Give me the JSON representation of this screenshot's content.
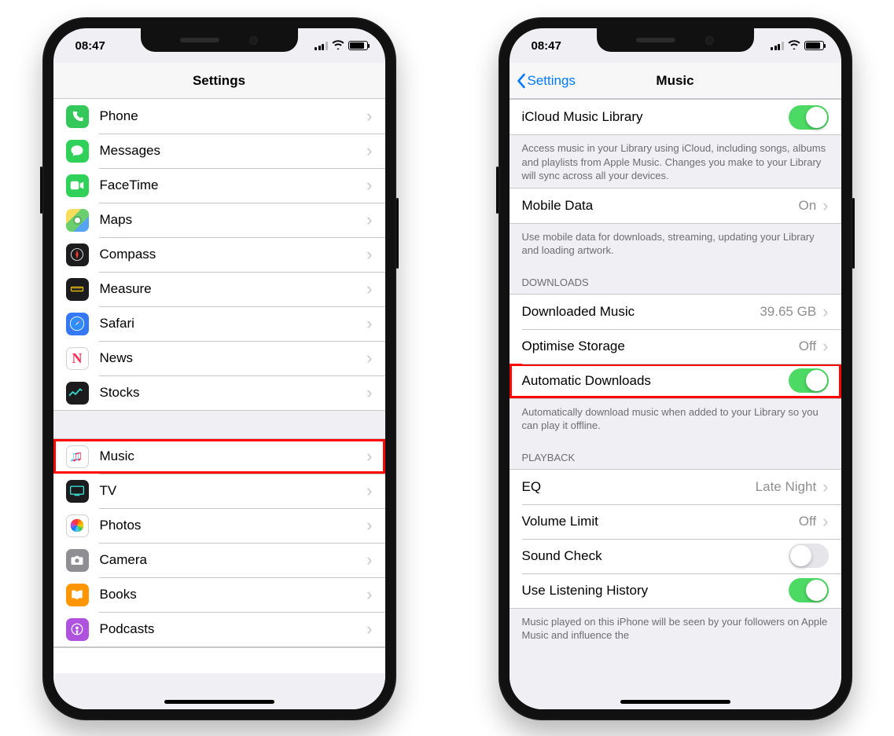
{
  "status": {
    "time": "08:47"
  },
  "left": {
    "title": "Settings",
    "group1": [
      {
        "label": "Phone",
        "icon": "phone-icon"
      },
      {
        "label": "Messages",
        "icon": "messages-icon"
      },
      {
        "label": "FaceTime",
        "icon": "facetime-icon"
      },
      {
        "label": "Maps",
        "icon": "maps-icon"
      },
      {
        "label": "Compass",
        "icon": "compass-icon"
      },
      {
        "label": "Measure",
        "icon": "measure-icon"
      },
      {
        "label": "Safari",
        "icon": "safari-icon"
      },
      {
        "label": "News",
        "icon": "news-icon"
      },
      {
        "label": "Stocks",
        "icon": "stocks-icon"
      }
    ],
    "group2": [
      {
        "label": "Music",
        "icon": "music-icon",
        "highlight": true
      },
      {
        "label": "TV",
        "icon": "tv-icon"
      },
      {
        "label": "Photos",
        "icon": "photos-icon"
      },
      {
        "label": "Camera",
        "icon": "camera-icon"
      },
      {
        "label": "Books",
        "icon": "books-icon"
      },
      {
        "label": "Podcasts",
        "icon": "podcasts-icon"
      }
    ]
  },
  "right": {
    "back": "Settings",
    "title": "Music",
    "icloud": {
      "label": "iCloud Music Library",
      "on": true,
      "footer": "Access music in your Library using iCloud, including songs, albums and playlists from Apple Music. Changes you make to your Library will sync across all your devices."
    },
    "mobile": {
      "label": "Mobile Data",
      "value": "On",
      "footer": "Use mobile data for downloads, streaming, updating your Library and loading artwork."
    },
    "downloads_header": "DOWNLOADS",
    "downloads": {
      "downloaded": {
        "label": "Downloaded Music",
        "value": "39.65 GB"
      },
      "optimise": {
        "label": "Optimise Storage",
        "value": "Off"
      },
      "auto": {
        "label": "Automatic Downloads",
        "on": true,
        "highlight": true
      },
      "footer": "Automatically download music when added to your Library so you can play it offline."
    },
    "playback_header": "PLAYBACK",
    "playback": {
      "eq": {
        "label": "EQ",
        "value": "Late Night"
      },
      "vol": {
        "label": "Volume Limit",
        "value": "Off"
      },
      "sound": {
        "label": "Sound Check",
        "on": false
      },
      "history": {
        "label": "Use Listening History",
        "on": true
      },
      "footer": "Music played on this iPhone will be seen by your followers on Apple Music and influence the"
    }
  }
}
